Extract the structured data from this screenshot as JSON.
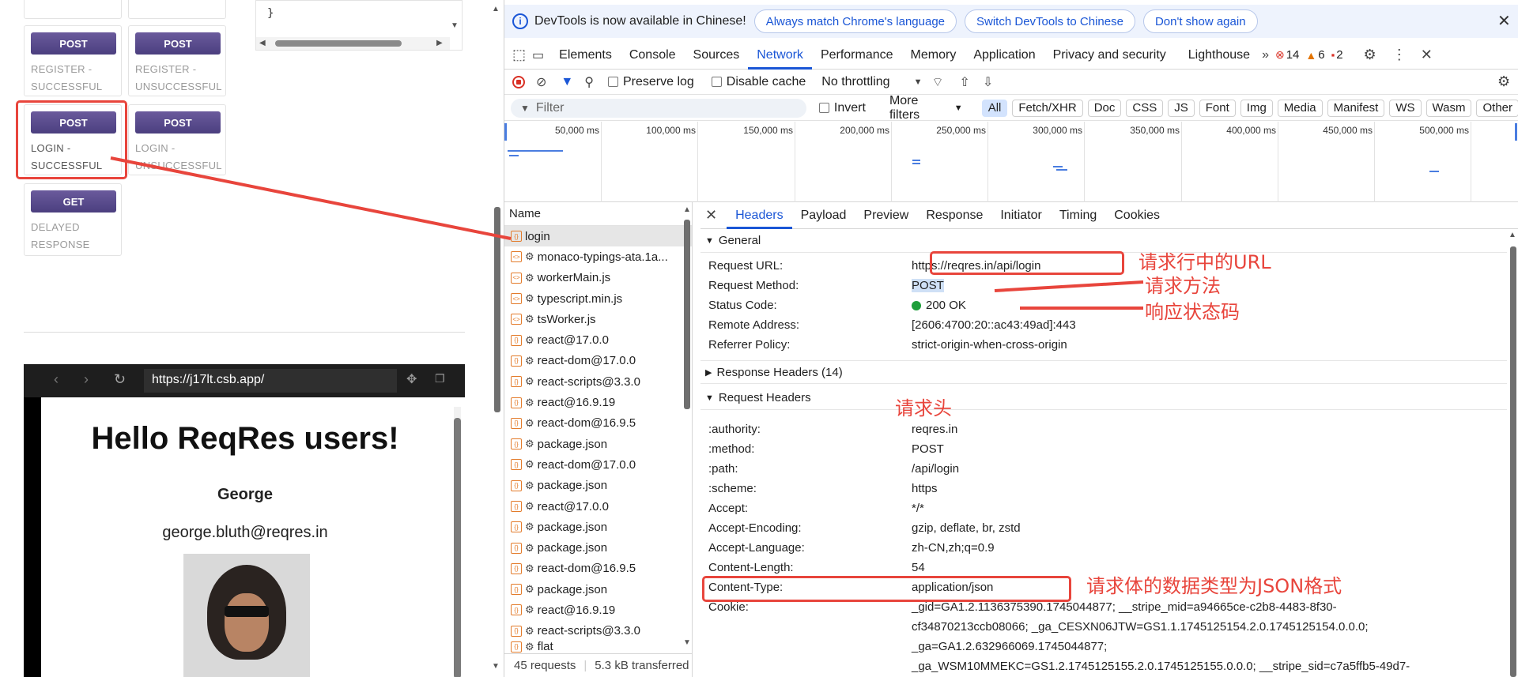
{
  "left": {
    "code_text": "}",
    "cards": [
      {
        "method": "POST",
        "label": "REGISTER - SUCCESSFUL"
      },
      {
        "method": "POST",
        "label": "REGISTER - UNSUCCESSFUL"
      },
      {
        "method": "POST",
        "label": "LOGIN - SUCCESSFUL"
      },
      {
        "method": "POST",
        "label": "LOGIN - UNSUCCESSFUL"
      },
      {
        "method": "GET",
        "label": "DELAYED RESPONSE"
      }
    ],
    "browser": {
      "url": "https://j17lt.csb.app/",
      "heading": "Hello ReqRes users!",
      "user_name": "George",
      "user_email": "george.bluth@reqres.in"
    }
  },
  "devtools": {
    "infobar": {
      "message": "DevTools is now available in Chinese!",
      "btn_match": "Always match Chrome's language",
      "btn_switch": "Switch DevTools to Chinese",
      "btn_dont": "Don't show again"
    },
    "tabs": [
      "Elements",
      "Console",
      "Sources",
      "Network",
      "Performance",
      "Memory",
      "Application",
      "Privacy and security",
      "Lighthouse"
    ],
    "active_tab": "Network",
    "counts": {
      "errors": "14",
      "warnings": "6",
      "issues": "2"
    },
    "toolbar": {
      "preserve_log": "Preserve log",
      "disable_cache": "Disable cache",
      "throttling": "No throttling"
    },
    "filter": {
      "placeholder": "Filter",
      "invert": "Invert",
      "more_filters": "More filters",
      "types": [
        "All",
        "Fetch/XHR",
        "Doc",
        "CSS",
        "JS",
        "Font",
        "Img",
        "Media",
        "Manifest",
        "WS",
        "Wasm",
        "Other"
      ]
    },
    "timeline_ticks": [
      "50,000 ms",
      "100,000 ms",
      "150,000 ms",
      "200,000 ms",
      "250,000 ms",
      "300,000 ms",
      "350,000 ms",
      "400,000 ms",
      "450,000 ms",
      "500,000 ms"
    ],
    "name_header": "Name",
    "requests": [
      "login",
      "monaco-typings-ata.1a...",
      "workerMain.js",
      "typescript.min.js",
      "tsWorker.js",
      "react@17.0.0",
      "react-dom@17.0.0",
      "react-scripts@3.3.0",
      "react@16.9.19",
      "react-dom@16.9.5",
      "package.json",
      "react-dom@17.0.0",
      "package.json",
      "react@17.0.0",
      "package.json",
      "package.json",
      "react-dom@16.9.5",
      "package.json",
      "react@16.9.19",
      "react-scripts@3.3.0",
      "flat"
    ],
    "footer": {
      "requests": "45 requests",
      "transferred": "5.3 kB transferred"
    },
    "detail_tabs": [
      "Headers",
      "Payload",
      "Preview",
      "Response",
      "Initiator",
      "Timing",
      "Cookies"
    ],
    "general": {
      "title": "General",
      "rows": [
        {
          "k": "Request URL:",
          "v": "https://reqres.in/api/login"
        },
        {
          "k": "Request Method:",
          "v": "POST"
        },
        {
          "k": "Status Code:",
          "v": "200 OK"
        },
        {
          "k": "Remote Address:",
          "v": "[2606:4700:20::ac43:49ad]:443"
        },
        {
          "k": "Referrer Policy:",
          "v": "strict-origin-when-cross-origin"
        }
      ]
    },
    "response_headers": "Response Headers (14)",
    "request_headers": {
      "title": "Request Headers",
      "rows": [
        {
          "k": ":authority:",
          "v": "reqres.in"
        },
        {
          "k": ":method:",
          "v": "POST"
        },
        {
          "k": ":path:",
          "v": "/api/login"
        },
        {
          "k": ":scheme:",
          "v": "https"
        },
        {
          "k": "Accept:",
          "v": "*/*"
        },
        {
          "k": "Accept-Encoding:",
          "v": "gzip, deflate, br, zstd"
        },
        {
          "k": "Accept-Language:",
          "v": "zh-CN,zh;q=0.9"
        },
        {
          "k": "Content-Length:",
          "v": "54"
        },
        {
          "k": "Content-Type:",
          "v": "application/json"
        }
      ],
      "cookie_key": "Cookie:",
      "cookie_lines": [
        "_gid=GA1.2.1136375390.1745044877; __stripe_mid=a94665ce-c2b8-4483-8f30-",
        "cf34870213ccb08066; _ga_CESXN06JTW=GS1.1.1745125154.2.0.1745125154.0.0.0;",
        "_ga=GA1.2.632966069.1745044877;",
        "_ga_WSM10MMEKC=GS1.2.1745125155.2.0.1745125155.0.0.0; __stripe_sid=c7a5ffb5-49d7-"
      ]
    }
  },
  "annotations": {
    "url": "请求行中的URL",
    "method": "请求方法",
    "status": "响应状态码",
    "headers": "请求头",
    "content_type": "请求体的数据类型为JSON格式"
  },
  "colors": {
    "accent": "#1a56d6",
    "annotation": "#e8453c",
    "method_btn": "#55478a",
    "status_ok": "#1e9e3a"
  }
}
